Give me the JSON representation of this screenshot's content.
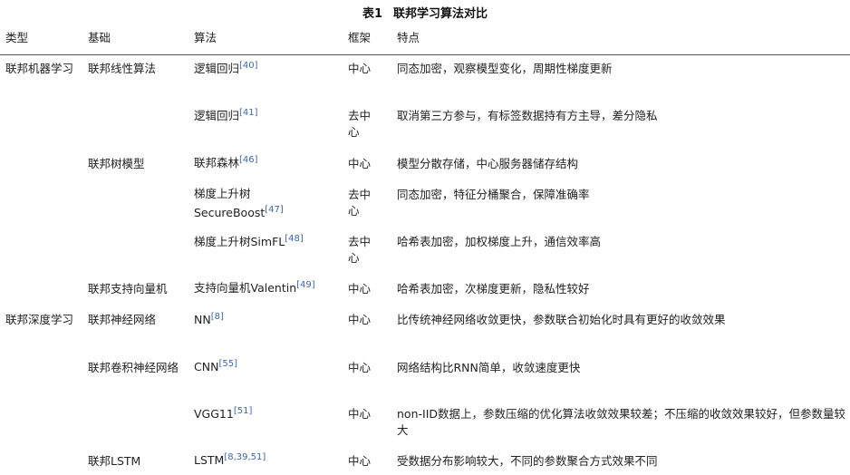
{
  "caption": {
    "number": "表1",
    "title": "联邦学习算法对比"
  },
  "headers": {
    "type": "类型",
    "basis": "基础",
    "algorithm": "算法",
    "framework": "框架",
    "features": "特点"
  },
  "rows": [
    {
      "type": "联邦机器学习",
      "basis": "联邦线性算法",
      "alg": "逻辑回归",
      "cite": "[40]",
      "frame": "中心",
      "feat": "同态加密，观察模型变化，周期性梯度更新"
    },
    {
      "type": "",
      "basis": "",
      "alg": "逻辑回归",
      "cite": "[41]",
      "frame": "去中心",
      "feat": "取消第三方参与，有标签数据持有方主导，差分隐私"
    },
    {
      "type": "",
      "basis": "联邦树模型",
      "alg": "联邦森林",
      "cite": "[46]",
      "frame": "中心",
      "feat": "模型分散存储，中心服务器储存结构"
    },
    {
      "type": "",
      "basis": "",
      "alg": "梯度上升树 SecureBoost",
      "cite": "[47]",
      "frame": "去中心",
      "feat": "同态加密，特征分桶聚合，保障准确率"
    },
    {
      "type": "",
      "basis": "",
      "alg": "梯度上升树SimFL",
      "cite": "[48]",
      "frame": "去中心",
      "feat": "哈希表加密，加权梯度上升，通信效率高"
    },
    {
      "type": "",
      "basis": "联邦支持向量机",
      "alg": "支持向量机Valentin",
      "cite": "[49]",
      "frame": "中心",
      "feat": "哈希表加密，次梯度更新，隐私性较好"
    },
    {
      "type": "联邦深度学习",
      "basis": "联邦神经网络",
      "alg": "NN",
      "cite": "[8]",
      "frame": "中心",
      "feat": "比传统神经网络收敛更快，参数联合初始化时具有更好的收敛效果"
    },
    {
      "type": "",
      "basis": "联邦卷积神经网络",
      "alg": "CNN",
      "cite": "[55]",
      "frame": "中心",
      "feat": "网络结构比RNN简单，收敛速度更快"
    },
    {
      "type": "",
      "basis": "",
      "alg": "VGG11",
      "cite": "[51]",
      "frame": "中心",
      "feat": "non-IID数据上，参数压缩的优化算法收敛效果较差；不压缩的收敛效果较好，但参数量较大"
    },
    {
      "type": "",
      "basis": "联邦LSTM",
      "alg": "LSTM",
      "cite": "[8,39,51]",
      "frame": "中心",
      "feat": "受数据分布影响较大，不同的参数聚合方式效果不同"
    }
  ]
}
